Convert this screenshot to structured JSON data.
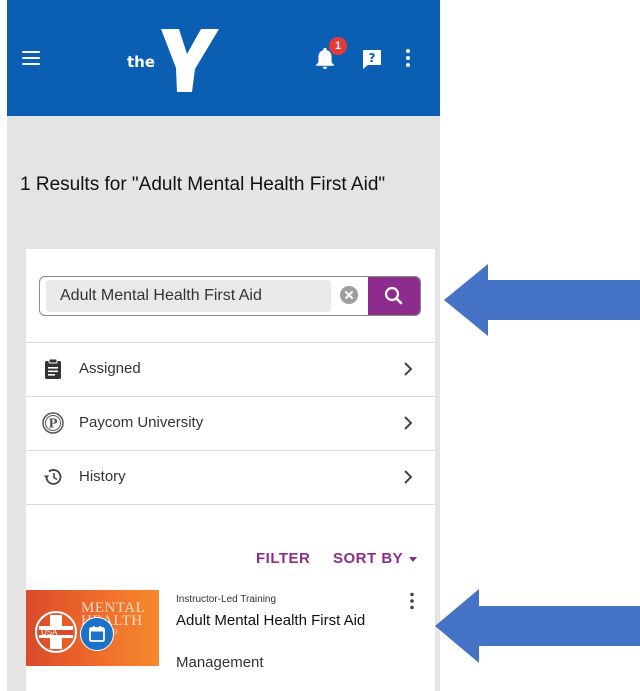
{
  "header": {
    "logo_text": "the",
    "notification_count": "1",
    "icons": [
      "menu-icon",
      "ymca-logo",
      "bell-icon",
      "help-icon",
      "more-vert-icon"
    ]
  },
  "results_title": "1 Results for \"Adult Mental Health First Aid\"",
  "search": {
    "value": "Adult Mental Health First Aid",
    "placeholder": ""
  },
  "nav": {
    "items": [
      {
        "label": "Assigned",
        "icon": "clipboard-icon"
      },
      {
        "label": "Paycom University",
        "icon": "paycom-icon"
      },
      {
        "label": "History",
        "icon": "history-icon"
      }
    ]
  },
  "actions": {
    "filter_label": "FILTER",
    "sort_label": "SORT BY"
  },
  "course": {
    "type": "Instructor-Led Training",
    "title": "Adult Mental Health First Aid",
    "category": "Management",
    "thumb_line1": "MENTAL",
    "thumb_line2": "HEALTH",
    "thumb_line3": "FIRST AID",
    "thumb_usa": "USA"
  },
  "colors": {
    "header": "#0b5fb3",
    "accent": "#8e2c8e",
    "badge": "#e53935",
    "arrow": "#4472c4",
    "thumbnail": "#ef6c2a"
  }
}
